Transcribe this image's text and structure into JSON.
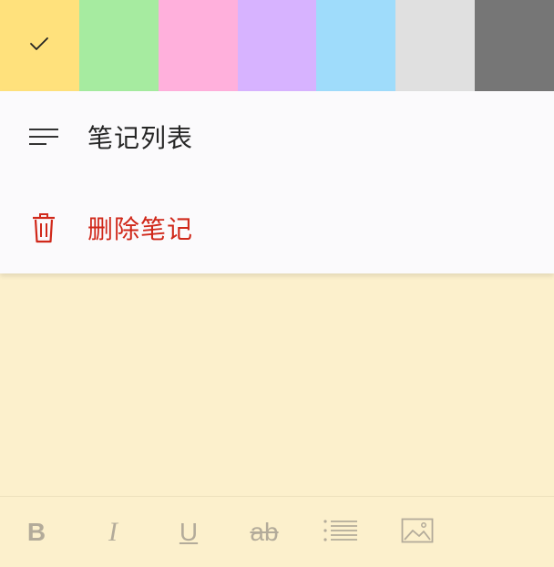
{
  "color_palette": {
    "swatches": [
      {
        "name": "yellow",
        "color": "#ffe17c",
        "selected": true
      },
      {
        "name": "green",
        "color": "#a6eba0"
      },
      {
        "name": "pink",
        "color": "#ffb0dc"
      },
      {
        "name": "purple",
        "color": "#d7b3ff"
      },
      {
        "name": "blue",
        "color": "#9fdcfb"
      },
      {
        "name": "gray",
        "color": "#e0e0e0"
      },
      {
        "name": "charcoal",
        "color": "#767676"
      }
    ],
    "selected_icon": "check-icon"
  },
  "menu": {
    "items": [
      {
        "label": "笔记列表",
        "icon": "list-icon",
        "color": "#262626"
      },
      {
        "label": "删除笔记",
        "icon": "trash-icon",
        "color": "#d0281a"
      }
    ]
  },
  "note": {
    "background": "#fcf0cc",
    "text": ""
  },
  "toolbar": {
    "bold_label": "B",
    "italic_label": "I",
    "underline_label": "U",
    "strike_label": "ab",
    "tools": [
      "bold",
      "italic",
      "underline",
      "strikethrough",
      "bullet-list",
      "image"
    ],
    "icon_color": "#b3ab9a"
  }
}
